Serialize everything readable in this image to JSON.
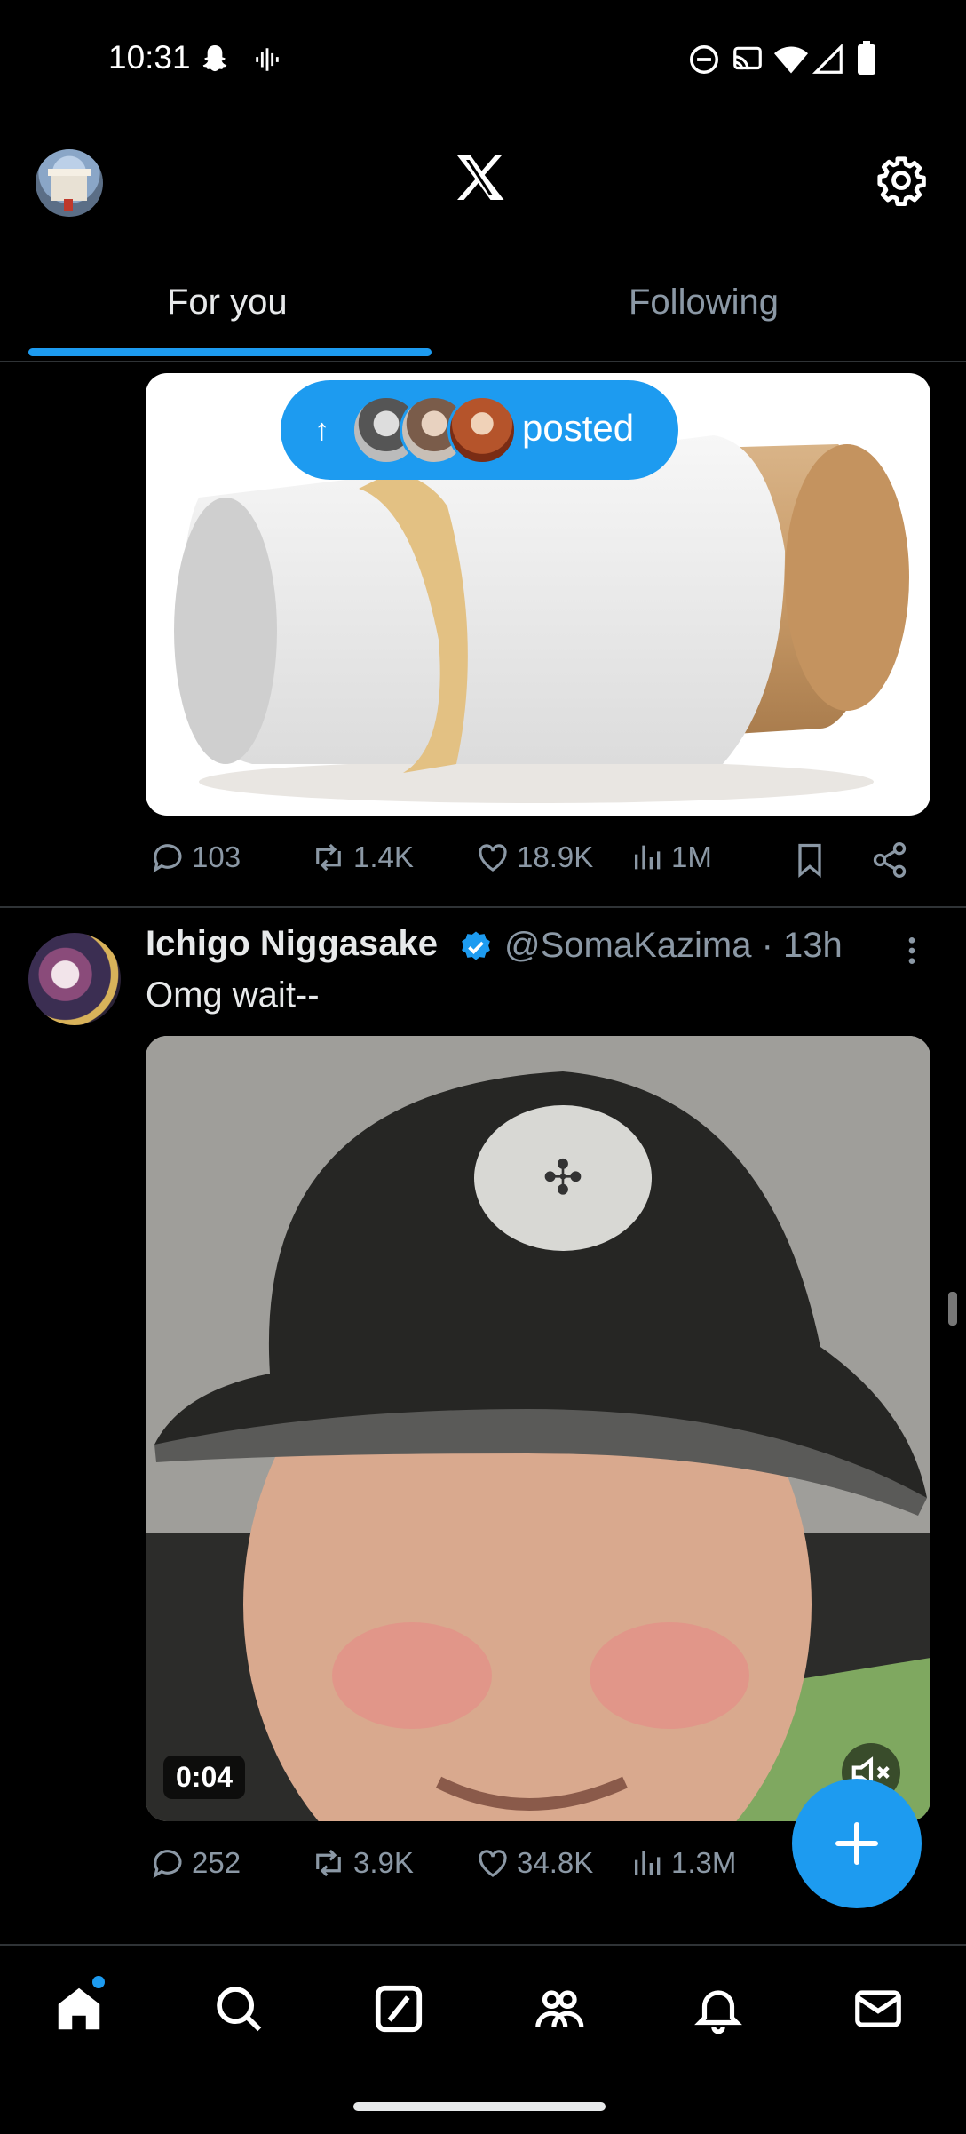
{
  "status_bar": {
    "time": "10:31"
  },
  "header": {
    "logo": "X",
    "settings_icon": "gear-icon"
  },
  "tabs": [
    {
      "label": "For you"
    },
    {
      "label": "Following"
    }
  ],
  "new_posts_pill": {
    "label": "posted"
  },
  "post1": {
    "replies": "103",
    "reposts": "1.4K",
    "likes": "18.9K",
    "views": "1M"
  },
  "post2": {
    "name": "Ichigo Niggasake",
    "handle": "@SomaKazima · 13h",
    "text": "Omg wait--",
    "video_duration": "0:04",
    "replies": "252",
    "reposts": "3.9K",
    "likes": "34.8K",
    "views": "1.3M"
  },
  "colors": {
    "accent": "#1d9bf0",
    "background": "#000000",
    "muted": "#8b98a5"
  },
  "bottom_nav": [
    "home-icon",
    "search-icon",
    "grok-icon",
    "communities-icon",
    "notifications-icon",
    "messages-icon"
  ]
}
